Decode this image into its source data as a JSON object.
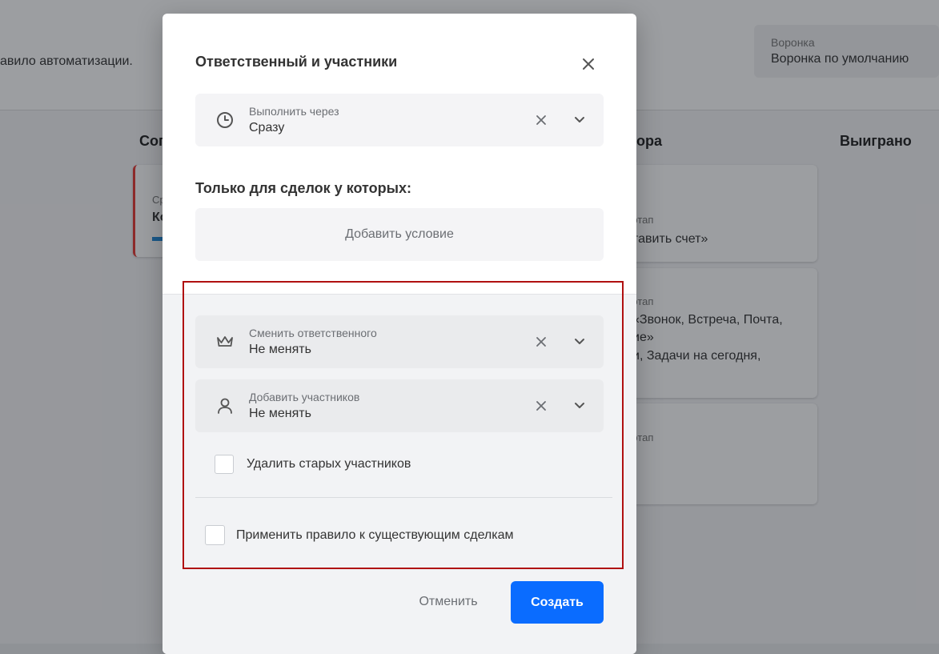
{
  "background": {
    "header_text": "авило автоматизации.",
    "funnel": {
      "label": "Воронка",
      "value": "Воронка по умолчанию"
    },
    "columns": [
      "Сог",
      "ора",
      "Выиграно"
    ],
    "cards": [
      {
        "muted": "Ср",
        "text": "Ко"
      },
      {
        "muted": "этап",
        "text": "тавить счет»"
      },
      {
        "muted": "этап",
        "line1": "«Звонок, Встреча, Почта,",
        "line2": "ие»",
        "line3": "и, Задачи на сегодня,"
      },
      {
        "muted": "этап"
      }
    ]
  },
  "modal": {
    "title": "Ответственный и участники",
    "execute_field": {
      "label": "Выполнить через",
      "value": "Сразу",
      "icon": "clock-icon"
    },
    "section_title": "Только для сделок у которых:",
    "add_condition_label": "Добавить условие",
    "change_owner_field": {
      "label": "Сменить ответственного",
      "value": "Не менять",
      "icon": "crown-icon"
    },
    "add_participants_field": {
      "label": "Добавить участников",
      "value": "Не менять",
      "icon": "user-icon"
    },
    "remove_old_label": "Удалить старых участников",
    "apply_existing_label": "Применить правило к существующим сделкам",
    "cancel_label": "Отменить",
    "create_label": "Создать"
  },
  "colors": {
    "primary_button": "#0a6cff",
    "highlight_border": "#b01010"
  }
}
